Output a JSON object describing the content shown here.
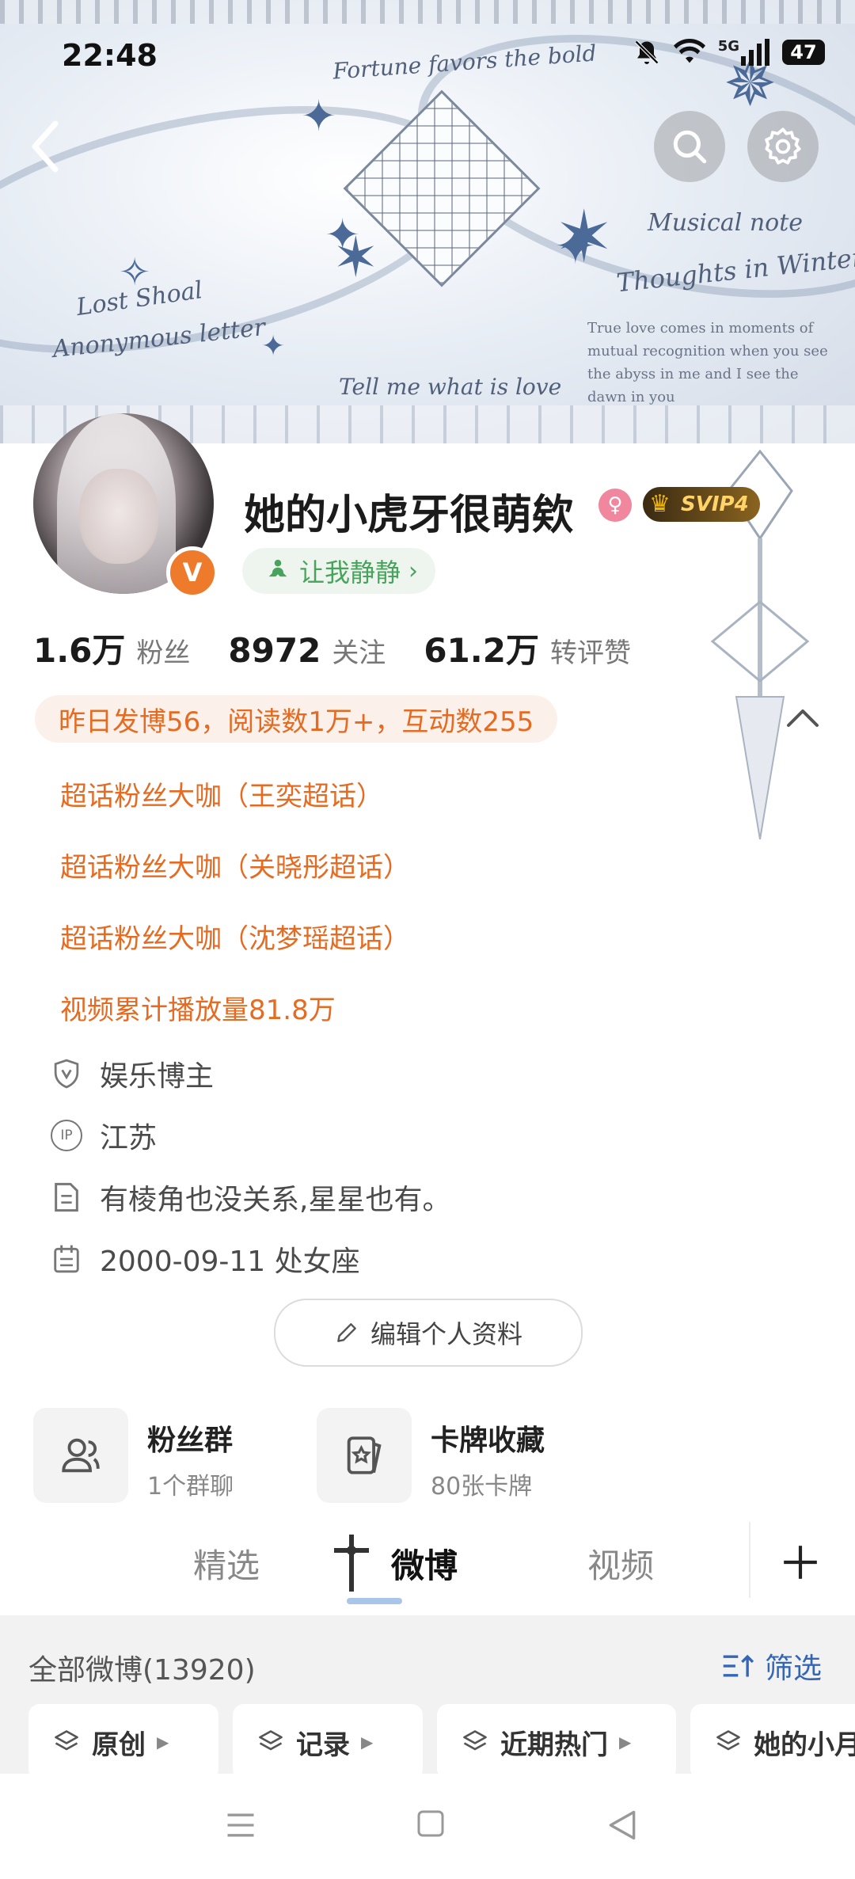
{
  "status_bar": {
    "time": "22:48",
    "network": "5G",
    "battery": "47"
  },
  "banner": {
    "script_1": "Fortune favors the bold",
    "script_2": "Musical note",
    "script_3": "Thoughts in Winter",
    "script_4": "Lost Shoal",
    "script_5": "Anonymous letter",
    "script_6": "Tell me what is love",
    "paragraph": "True love comes in moments of mutual recognition when you see the abyss in me and I see the dawn in you"
  },
  "header_buttons": {
    "back": "back-icon",
    "search": "search-icon",
    "settings": "gear-icon"
  },
  "profile": {
    "username": "她的小虎牙很萌欸",
    "vip_label": "SVIP4",
    "status_text": "让我静静",
    "status_arrow": "›",
    "verified_mark": "V"
  },
  "stats": [
    {
      "value": "1.6万",
      "label": "粉丝"
    },
    {
      "value": "8972",
      "label": "关注"
    },
    {
      "value": "61.2万",
      "label": "转评赞"
    }
  ],
  "summary": "昨日发博56，阅读数1万+，互动数255",
  "honors": [
    "超话粉丝大咖（王奕超话）",
    "超话粉丝大咖（关晓彤超话）",
    "超话粉丝大咖（沈梦瑶超话）",
    "视频累计播放量81.8万"
  ],
  "info": {
    "category": "娱乐博主",
    "ip_badge": "IP",
    "location": "江苏",
    "bio": "有棱角也没关系,星星也有。",
    "birthday": "2000-09-11 处女座"
  },
  "edit_profile_label": "编辑个人资料",
  "cards": [
    {
      "title": "粉丝群",
      "subtitle": "1个群聊"
    },
    {
      "title": "卡牌收藏",
      "subtitle": "80张卡牌"
    }
  ],
  "tabs": [
    "精选",
    "微博",
    "视频"
  ],
  "feed": {
    "title": "全部微博(13920)",
    "filter_label": "筛选",
    "chips": [
      "原创",
      "记录",
      "近期热门",
      "她的小月"
    ]
  },
  "colors": {
    "accent_orange": "#e56b22",
    "link_blue": "#3566b5",
    "status_green": "#49a35c"
  }
}
